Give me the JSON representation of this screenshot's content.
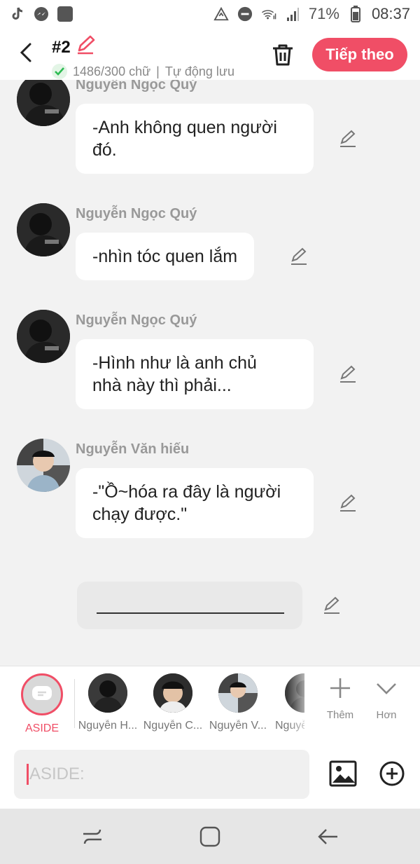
{
  "status_bar": {
    "battery": "71%",
    "time": "08:37"
  },
  "header": {
    "chapter": "#2",
    "word_count": "1486/300 chữ",
    "autosave": "Tự động lưu",
    "next_label": "Tiếp theo"
  },
  "messages": [
    {
      "sender": "Nguyễn Ngọc Quý",
      "text": "-Anh không quen người\nđó."
    },
    {
      "sender": "Nguyễn Ngọc Quý",
      "text": "-nhìn tóc quen lắm"
    },
    {
      "sender": "Nguyễn Ngọc Quý",
      "text": "-Hình như là anh chủ\nnhà này thì phải..."
    },
    {
      "sender": "Nguyễn Văn hiếu",
      "text": "-\"Ồ~hóa ra đây là người\nchạy được.\""
    }
  ],
  "characters": {
    "aside_label": "ASIDE",
    "items": [
      {
        "name": "Nguyễn H..."
      },
      {
        "name": "Nguyễn C..."
      },
      {
        "name": "Nguyễn V..."
      },
      {
        "name": "Nguyễ"
      }
    ],
    "add_label": "Thêm",
    "more_label": "Hơn"
  },
  "input": {
    "placeholder": "ASIDE:"
  },
  "colors": {
    "accent": "#f04e66",
    "background": "#f2f2f2"
  }
}
